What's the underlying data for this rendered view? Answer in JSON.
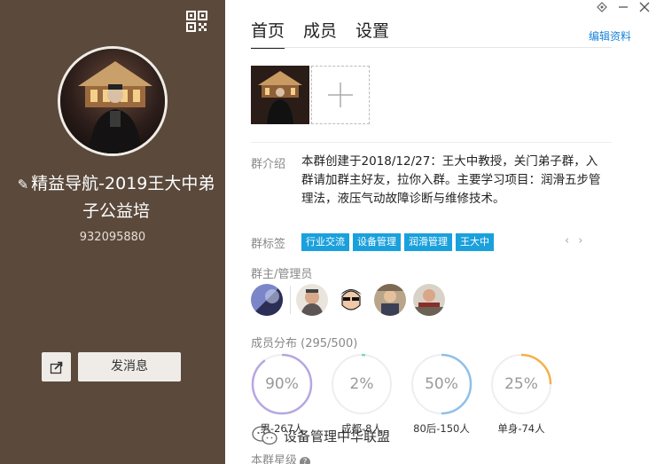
{
  "left": {
    "group_name": "精益导航-2019王大中弟子公益培",
    "group_id": "932095880",
    "send_message_label": "发消息"
  },
  "tabs": [
    "首页",
    "成员",
    "设置"
  ],
  "edit_label": "编辑资料",
  "intro": {
    "label": "群介绍",
    "text": "本群创建于2018/12/27：王大中教授，关门弟子群，入群请加群主好友，拉你入群。主要学习项目：润滑五步管理法，液压气动故障诊断与维修技术。"
  },
  "tags": {
    "label": "群标签",
    "items": [
      "行业交流",
      "设备管理",
      "润滑管理",
      "王大中"
    ]
  },
  "admins_label": "群主/管理员",
  "distribution": {
    "label": "成员分布 (295/500)",
    "items": [
      {
        "percent_label": "90%",
        "value": 90,
        "caption": "男-267人",
        "color": "#b6a7e2"
      },
      {
        "percent_label": "2%",
        "value": 2,
        "caption": "成都-8人",
        "color": "#7fd6c0"
      },
      {
        "percent_label": "50%",
        "value": 50,
        "caption": "80后-150人",
        "color": "#8fc0e8"
      },
      {
        "percent_label": "25%",
        "value": 25,
        "caption": "单身-74人",
        "color": "#f2b24a"
      }
    ]
  },
  "star_label": "本群星级",
  "watermark": "设备管理中华联盟",
  "colors": {
    "left_bg": "#5b4a3c",
    "tag_bg": "#1aa0dc",
    "link": "#1a83d6"
  }
}
